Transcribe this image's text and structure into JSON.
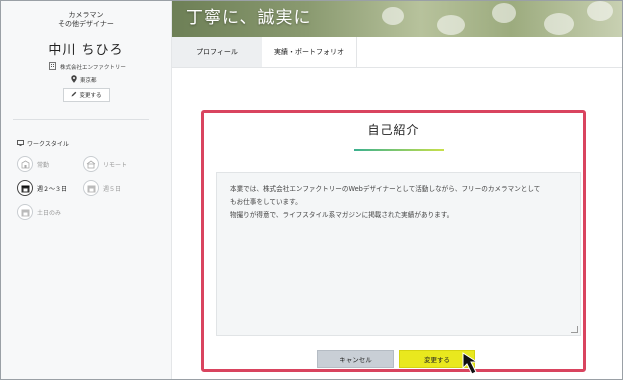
{
  "sidebar": {
    "role_line1": "カメラマン",
    "role_line2": "その他デザイナー",
    "name": "中川 ちひろ",
    "company": "株式会社エンファクトリー",
    "location": "東京都",
    "change_label": "変更する",
    "workstyle_title": "ワークスタイル",
    "workstyles": [
      {
        "label": "常勤",
        "icon": "building-icon",
        "active": false
      },
      {
        "label": "リモート",
        "icon": "remote-icon",
        "active": false
      },
      {
        "label": "週２～３日",
        "icon": "calendar-icon",
        "active": true
      },
      {
        "label": "週５日",
        "icon": "calendar-icon",
        "active": false
      },
      {
        "label": "土日のみ",
        "icon": "calendar-icon",
        "active": false
      }
    ]
  },
  "hero": {
    "title": "丁寧に、誠実に"
  },
  "tabs": [
    {
      "label": "プロフィール",
      "active": true
    },
    {
      "label": "実績・ポートフォリオ",
      "active": false
    }
  ],
  "card": {
    "title": "自己紹介",
    "body_lines": [
      "本業では、株式会社エンファクトリーのWebデザイナーとして活動しながら、フリーのカメラマンとして",
      "もお仕事をしています。",
      "物撮りが得意で、ライフスタイル系マガジンに掲載された実績があります。"
    ],
    "cancel_label": "キャンセル",
    "save_label": "変更する"
  },
  "colors": {
    "highlight_border": "#d9445f",
    "save_button": "#e9e81e",
    "cancel_button": "#c9cfd6",
    "rule_start": "#3bb08f",
    "rule_end": "#c9e04a"
  }
}
